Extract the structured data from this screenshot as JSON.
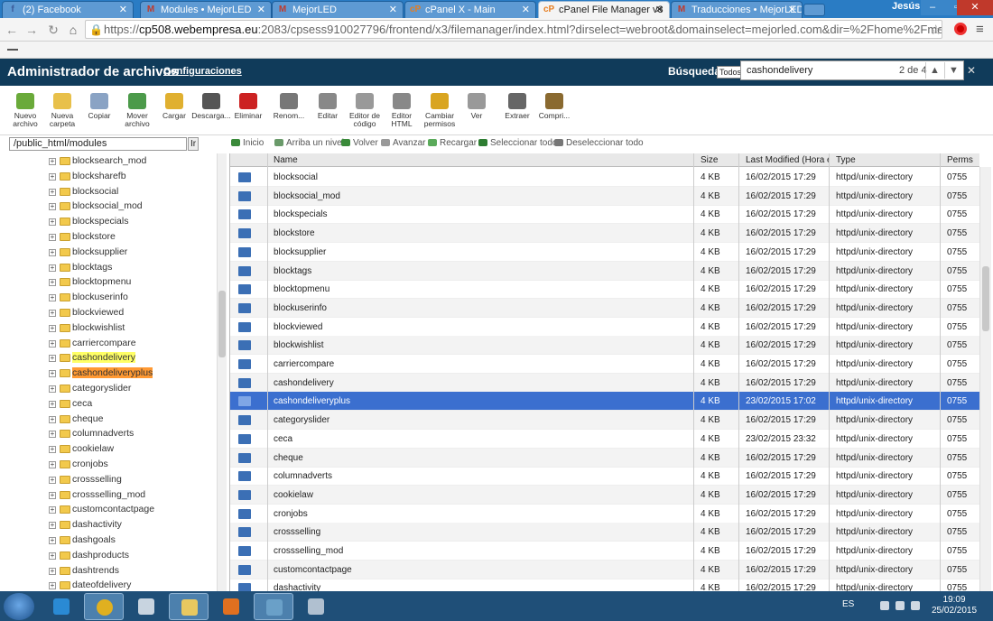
{
  "browser": {
    "tabs": [
      {
        "label": "(2) Facebook",
        "icon_text": "f",
        "icon_color": "#3b5998",
        "active": false
      },
      {
        "label": "Modules • MejorLED",
        "icon_text": "M",
        "icon_color": "#c0392b",
        "active": false
      },
      {
        "label": "MejorLED",
        "icon_text": "M",
        "icon_color": "#c0392b",
        "active": false
      },
      {
        "label": "cPanel X - Main",
        "icon_text": "cP",
        "icon_color": "#e67e22",
        "active": false
      },
      {
        "label": "cPanel File Manager v3",
        "icon_text": "cP",
        "icon_color": "#e67e22",
        "active": true
      },
      {
        "label": "Traducciones • MejorLED",
        "icon_text": "M",
        "icon_color": "#c0392b",
        "active": false
      }
    ],
    "user": "Jesús",
    "url_scheme": "https://",
    "url_host": "cp508.webempresa.eu",
    "url_rest": ":2083/cpsess910027796/frontend/x3/filemanager/index.html?dirselect=webroot&domainselect=mejorled.com&dir=%2Fhome%2Fmejorled"
  },
  "app": {
    "title": "Administrador de archivos",
    "config_link": "Configuraciones",
    "search_label": "Búsqueda",
    "search_scope": "Todos",
    "find_query": "cashondelivery",
    "find_count": "2 de 4"
  },
  "toolbar": [
    {
      "label": "Nuevo archivo",
      "icon": "new-file-icon",
      "color": "#6aaa3a"
    },
    {
      "label": "Nueva carpeta",
      "icon": "new-folder-icon",
      "color": "#e8c04a"
    },
    {
      "label": "Copiar",
      "icon": "copy-icon",
      "color": "#8aa3c4"
    },
    {
      "label": "Mover archivo",
      "icon": "move-file-icon",
      "color": "#4c9a4a"
    },
    {
      "label": "Cargar",
      "icon": "upload-icon",
      "color": "#e0b030"
    },
    {
      "label": "Descarga...",
      "icon": "download-icon",
      "color": "#555555"
    },
    {
      "label": "Eliminar",
      "icon": "delete-icon",
      "color": "#cc2222"
    },
    {
      "label": "Renom...",
      "icon": "rename-icon",
      "color": "#777777"
    },
    {
      "label": "Editar",
      "icon": "edit-icon",
      "color": "#888888"
    },
    {
      "label": "Editor de código",
      "icon": "code-editor-icon",
      "color": "#999999"
    },
    {
      "label": "Editor HTML",
      "icon": "html-editor-icon",
      "color": "#888888"
    },
    {
      "label": "Cambiar permisos",
      "icon": "permissions-icon",
      "color": "#d9a520"
    },
    {
      "label": "Ver",
      "icon": "view-icon",
      "color": "#999999"
    },
    {
      "label": "Extraer",
      "icon": "extract-icon",
      "color": "#666666"
    },
    {
      "label": "Compri...",
      "icon": "compress-icon",
      "color": "#8a6a30"
    }
  ],
  "tree": {
    "path": "/public_html/modules",
    "go_label": "Ir",
    "items": [
      {
        "label": "blocksearch_mod",
        "hl": ""
      },
      {
        "label": "blocksharefb",
        "hl": ""
      },
      {
        "label": "blocksocial",
        "hl": ""
      },
      {
        "label": "blocksocial_mod",
        "hl": ""
      },
      {
        "label": "blockspecials",
        "hl": ""
      },
      {
        "label": "blockstore",
        "hl": ""
      },
      {
        "label": "blocksupplier",
        "hl": ""
      },
      {
        "label": "blocktags",
        "hl": ""
      },
      {
        "label": "blocktopmenu",
        "hl": ""
      },
      {
        "label": "blockuserinfo",
        "hl": ""
      },
      {
        "label": "blockviewed",
        "hl": ""
      },
      {
        "label": "blockwishlist",
        "hl": ""
      },
      {
        "label": "carriercompare",
        "hl": ""
      },
      {
        "label": "cashondelivery",
        "hl": "hl1"
      },
      {
        "label": "cashondeliveryplus",
        "hl": "hl2"
      },
      {
        "label": "categoryslider",
        "hl": ""
      },
      {
        "label": "ceca",
        "hl": ""
      },
      {
        "label": "cheque",
        "hl": ""
      },
      {
        "label": "columnadverts",
        "hl": ""
      },
      {
        "label": "cookielaw",
        "hl": ""
      },
      {
        "label": "cronjobs",
        "hl": ""
      },
      {
        "label": "crossselling",
        "hl": ""
      },
      {
        "label": "crossselling_mod",
        "hl": ""
      },
      {
        "label": "customcontactpage",
        "hl": ""
      },
      {
        "label": "dashactivity",
        "hl": ""
      },
      {
        "label": "dashgoals",
        "hl": ""
      },
      {
        "label": "dashproducts",
        "hl": ""
      },
      {
        "label": "dashtrends",
        "hl": ""
      },
      {
        "label": "dateofdelivery",
        "hl": ""
      }
    ]
  },
  "actions": [
    {
      "label": "Inicio",
      "color": "#3a8a3a"
    },
    {
      "label": "Arriba un nivel",
      "color": "#6a9a6a"
    },
    {
      "label": "Volver",
      "color": "#3a8a3a"
    },
    {
      "label": "Avanzar",
      "color": "#999999"
    },
    {
      "label": "Recargar",
      "color": "#5aaa5a"
    },
    {
      "label": "Seleccionar todo",
      "color": "#2e7d32"
    },
    {
      "label": "Deseleccionar todo",
      "color": "#777777"
    }
  ],
  "list": {
    "columns": [
      "Name",
      "Size",
      "Last Modified (Hora está",
      "Type",
      "Perms"
    ],
    "rows": [
      {
        "name": "blocksocial",
        "size": "4 KB",
        "modified": "16/02/2015 17:29",
        "type": "httpd/unix-directory",
        "perms": "0755"
      },
      {
        "name": "blocksocial_mod",
        "size": "4 KB",
        "modified": "16/02/2015 17:29",
        "type": "httpd/unix-directory",
        "perms": "0755"
      },
      {
        "name": "blockspecials",
        "size": "4 KB",
        "modified": "16/02/2015 17:29",
        "type": "httpd/unix-directory",
        "perms": "0755"
      },
      {
        "name": "blockstore",
        "size": "4 KB",
        "modified": "16/02/2015 17:29",
        "type": "httpd/unix-directory",
        "perms": "0755"
      },
      {
        "name": "blocksupplier",
        "size": "4 KB",
        "modified": "16/02/2015 17:29",
        "type": "httpd/unix-directory",
        "perms": "0755"
      },
      {
        "name": "blocktags",
        "size": "4 KB",
        "modified": "16/02/2015 17:29",
        "type": "httpd/unix-directory",
        "perms": "0755"
      },
      {
        "name": "blocktopmenu",
        "size": "4 KB",
        "modified": "16/02/2015 17:29",
        "type": "httpd/unix-directory",
        "perms": "0755"
      },
      {
        "name": "blockuserinfo",
        "size": "4 KB",
        "modified": "16/02/2015 17:29",
        "type": "httpd/unix-directory",
        "perms": "0755"
      },
      {
        "name": "blockviewed",
        "size": "4 KB",
        "modified": "16/02/2015 17:29",
        "type": "httpd/unix-directory",
        "perms": "0755"
      },
      {
        "name": "blockwishlist",
        "size": "4 KB",
        "modified": "16/02/2015 17:29",
        "type": "httpd/unix-directory",
        "perms": "0755"
      },
      {
        "name": "carriercompare",
        "size": "4 KB",
        "modified": "16/02/2015 17:29",
        "type": "httpd/unix-directory",
        "perms": "0755"
      },
      {
        "name": "cashondelivery",
        "size": "4 KB",
        "modified": "16/02/2015 17:29",
        "type": "httpd/unix-directory",
        "perms": "0755"
      },
      {
        "name": "cashondeliveryplus",
        "size": "4 KB",
        "modified": "23/02/2015 17:02",
        "type": "httpd/unix-directory",
        "perms": "0755",
        "selected": true
      },
      {
        "name": "categoryslider",
        "size": "4 KB",
        "modified": "16/02/2015 17:29",
        "type": "httpd/unix-directory",
        "perms": "0755"
      },
      {
        "name": "ceca",
        "size": "4 KB",
        "modified": "23/02/2015 23:32",
        "type": "httpd/unix-directory",
        "perms": "0755"
      },
      {
        "name": "cheque",
        "size": "4 KB",
        "modified": "16/02/2015 17:29",
        "type": "httpd/unix-directory",
        "perms": "0755"
      },
      {
        "name": "columnadverts",
        "size": "4 KB",
        "modified": "16/02/2015 17:29",
        "type": "httpd/unix-directory",
        "perms": "0755"
      },
      {
        "name": "cookielaw",
        "size": "4 KB",
        "modified": "16/02/2015 17:29",
        "type": "httpd/unix-directory",
        "perms": "0755"
      },
      {
        "name": "cronjobs",
        "size": "4 KB",
        "modified": "16/02/2015 17:29",
        "type": "httpd/unix-directory",
        "perms": "0755"
      },
      {
        "name": "crossselling",
        "size": "4 KB",
        "modified": "16/02/2015 17:29",
        "type": "httpd/unix-directory",
        "perms": "0755"
      },
      {
        "name": "crossselling_mod",
        "size": "4 KB",
        "modified": "16/02/2015 17:29",
        "type": "httpd/unix-directory",
        "perms": "0755"
      },
      {
        "name": "customcontactpage",
        "size": "4 KB",
        "modified": "16/02/2015 17:29",
        "type": "httpd/unix-directory",
        "perms": "0755"
      },
      {
        "name": "dashactivity",
        "size": "4 KB",
        "modified": "16/02/2015 17:29",
        "type": "httpd/unix-directory",
        "perms": "0755"
      }
    ]
  },
  "taskbar": {
    "apps": [
      {
        "icon": "internet-explorer-icon",
        "color": "#2a8ad4"
      },
      {
        "icon": "chrome-icon",
        "color": "#e0b020"
      },
      {
        "icon": "apps-grid-icon",
        "color": "#c8d4e0"
      },
      {
        "icon": "file-explorer-icon",
        "color": "#e8c860"
      },
      {
        "icon": "media-player-icon",
        "color": "#e07020"
      },
      {
        "icon": "network-icon",
        "color": "#6aa0c8"
      },
      {
        "icon": "tools-icon",
        "color": "#b0c0d0"
      }
    ],
    "lang": "ES",
    "time": "19:09",
    "date": "25/02/2015"
  }
}
